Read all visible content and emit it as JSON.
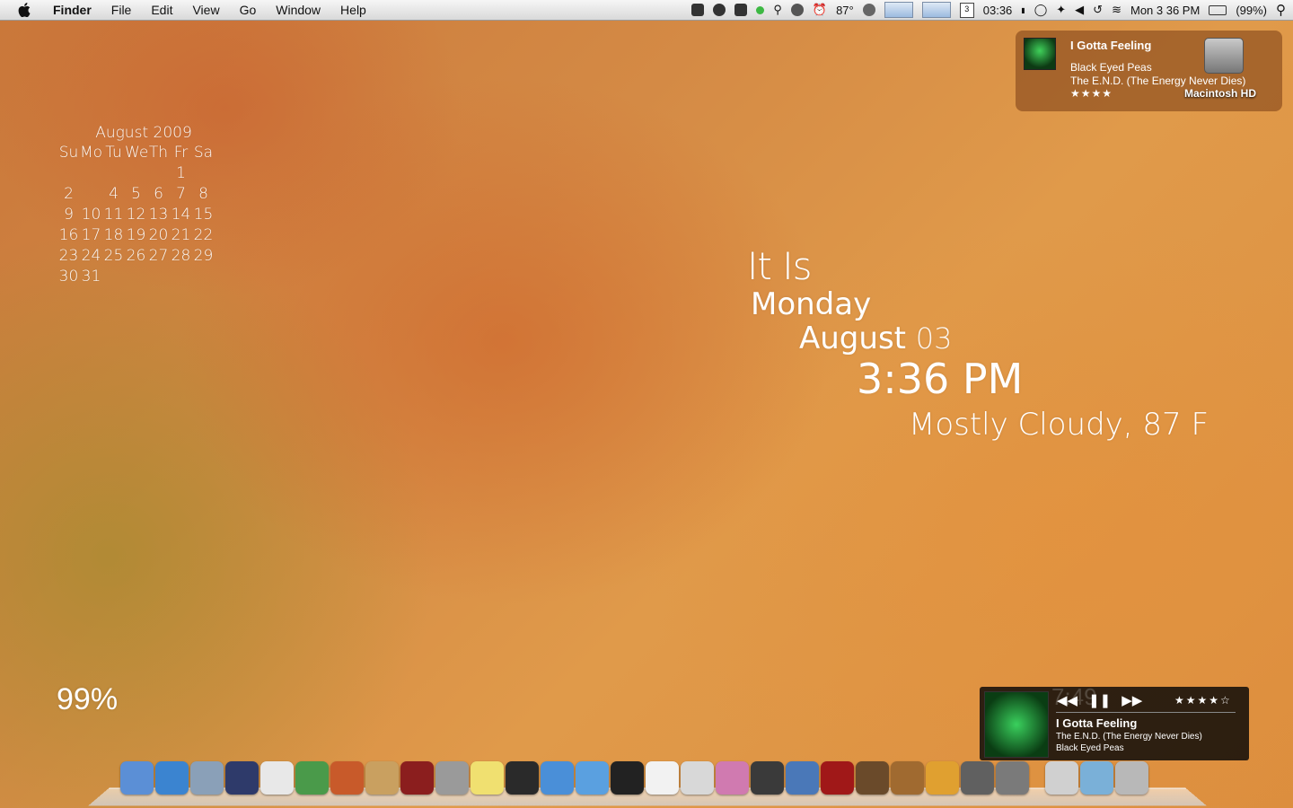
{
  "menubar": {
    "app_name": "Finder",
    "menus": [
      "File",
      "Edit",
      "View",
      "Go",
      "Window",
      "Help"
    ],
    "temperature": "87°",
    "clock_small": "03:36",
    "calendar_day": "3",
    "datetime": "Mon 3 36 PM",
    "battery": "(99%)"
  },
  "calendar": {
    "title": "August 2009",
    "weekdays": [
      "Su",
      "Mo",
      "Tu",
      "We",
      "Th",
      "Fr",
      "Sa"
    ],
    "weeks": [
      [
        "",
        "",
        "",
        "",
        "",
        "1",
        ""
      ],
      [
        "2",
        "",
        "4",
        "5",
        "6",
        "7",
        "8"
      ],
      [
        "9",
        "10",
        "11",
        "12",
        "13",
        "14",
        "15"
      ],
      [
        "16",
        "17",
        "18",
        "19",
        "20",
        "21",
        "22"
      ],
      [
        "23",
        "24",
        "25",
        "26",
        "27",
        "28",
        "29"
      ],
      [
        "30",
        "31",
        "",
        "",
        "",
        "",
        ""
      ]
    ]
  },
  "clock": {
    "intro": "It Is",
    "weekday": "Monday",
    "month": "August",
    "day": "03",
    "time": "3:36 PM",
    "weather": "Mostly Cloudy, 87 F"
  },
  "battery_widget": {
    "percent": "99%"
  },
  "notification": {
    "title": "I Gotta Feeling",
    "artist": "Black Eyed Peas",
    "album": "The E.N.D. (The Energy Never Dies)",
    "stars": "★★★★",
    "disk_label": "Macintosh HD"
  },
  "player": {
    "ghost_time": "7:49",
    "stars": "★★★★☆",
    "title": "I Gotta Feeling",
    "album": "The E.N.D. (The Energy Never Dies)",
    "artist": "Black Eyed Peas",
    "controls": [
      "◀◀",
      "❚❚",
      "▶▶"
    ]
  },
  "dock": {
    "apps": [
      {
        "name": "finder",
        "color": "#5b8fd6"
      },
      {
        "name": "safari",
        "color": "#3b84d0"
      },
      {
        "name": "mail-stamp",
        "color": "#8aa0b8"
      },
      {
        "name": "script-editor",
        "color": "#2e3a6a"
      },
      {
        "name": "textedit",
        "color": "#e8e8e8"
      },
      {
        "name": "numbers",
        "color": "#4a9a4a"
      },
      {
        "name": "keynote",
        "color": "#c85a2a"
      },
      {
        "name": "address-book",
        "color": "#c9a060"
      },
      {
        "name": "dictionary",
        "color": "#8b1e1e"
      },
      {
        "name": "calculator",
        "color": "#9a9a9a"
      },
      {
        "name": "stickies",
        "color": "#f0e070"
      },
      {
        "name": "dashboard",
        "color": "#2a2a2a"
      },
      {
        "name": "ichat",
        "color": "#4a8fd8"
      },
      {
        "name": "itunes",
        "color": "#5aa0e0"
      },
      {
        "name": "aperture",
        "color": "#222222"
      },
      {
        "name": "ical",
        "color": "#f2f2f2"
      },
      {
        "name": "font-book",
        "color": "#d8d8d8"
      },
      {
        "name": "color-sync",
        "color": "#d07ab0"
      },
      {
        "name": "preview-photo",
        "color": "#3a3a3a"
      },
      {
        "name": "iphoto",
        "color": "#4a78b8"
      },
      {
        "name": "photo-booth",
        "color": "#a01818"
      },
      {
        "name": "image-capture",
        "color": "#6a4a2a"
      },
      {
        "name": "garageband",
        "color": "#a06a30"
      },
      {
        "name": "pencil-app",
        "color": "#e0a030"
      },
      {
        "name": "imovie-star",
        "color": "#606060"
      },
      {
        "name": "system-preferences",
        "color": "#7a7a7a"
      }
    ],
    "right_items": [
      {
        "name": "documents-stack",
        "color": "#d0d0d0"
      },
      {
        "name": "downloads-folder",
        "color": "#7ab0d8"
      },
      {
        "name": "trash",
        "color": "#b8b8b8"
      }
    ]
  }
}
